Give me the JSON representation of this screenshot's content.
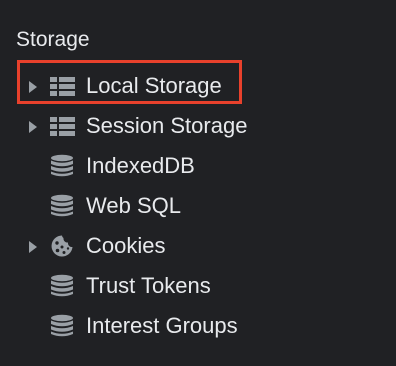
{
  "panel": {
    "title": "Storage"
  },
  "items": [
    {
      "label": "Local Storage",
      "icon": "table-grid-icon",
      "expandable": true,
      "highlighted": true
    },
    {
      "label": "Session Storage",
      "icon": "table-grid-icon",
      "expandable": true,
      "highlighted": false
    },
    {
      "label": "IndexedDB",
      "icon": "database-icon",
      "expandable": false,
      "highlighted": false
    },
    {
      "label": "Web SQL",
      "icon": "database-icon",
      "expandable": false,
      "highlighted": false
    },
    {
      "label": "Cookies",
      "icon": "cookie-icon",
      "expandable": true,
      "highlighted": false
    },
    {
      "label": "Trust Tokens",
      "icon": "database-icon",
      "expandable": false,
      "highlighted": false
    },
    {
      "label": "Interest Groups",
      "icon": "database-icon",
      "expandable": false,
      "highlighted": false
    }
  ],
  "colors": {
    "background": "#202124",
    "text": "#e8eaed",
    "icon": "#9aa0a6",
    "highlight_border": "#e8412c"
  }
}
